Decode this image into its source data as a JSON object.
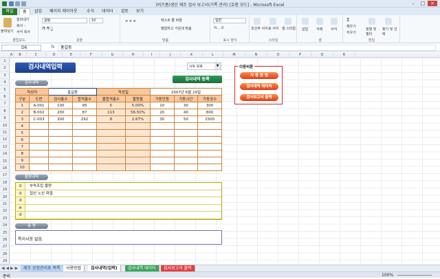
{
  "window": {
    "title": "(비즈폼)생산 제조 검사 보고서(기록 관리) [호환 모드] - Microsoft Excel"
  },
  "ribbon_tabs": [
    "파일",
    "홈",
    "삽입",
    "페이지 레이아웃",
    "수식",
    "데이터",
    "검토",
    "보기"
  ],
  "ribbon": {
    "clipboard": {
      "paste": "붙여넣기",
      "cut": "잘라내기",
      "copy": "복사 -",
      "format": "서식 복사",
      "label": "클립보드"
    },
    "font": {
      "name": "굴림",
      "size": "10",
      "label": "글꼴"
    },
    "align": {
      "wrap": "텍스트 줄 바꿈",
      "merge": "병합하고 가운데 맞춤",
      "label": "맞춤"
    },
    "number": {
      "format": "일반",
      "label": "표시 형식"
    },
    "styles": {
      "cond": "조건부 서식",
      "table": "표 서식",
      "cell": "셀 스타일",
      "label": "스타일"
    },
    "cells": {
      "insert": "삽입",
      "delete": "삭제",
      "format": "서식",
      "label": "셀"
    },
    "edit": {
      "sum": "Σ",
      "fill": "채우기",
      "clear": "지우기",
      "sort": "정렬 및 필터",
      "find": "찾기 및 선택",
      "label": "편집"
    }
  },
  "formula_bar": {
    "cell": "D6",
    "fx": "fx",
    "content": "홍길동"
  },
  "columns": [
    "A",
    "B",
    "C",
    "D",
    "E",
    "F",
    "G",
    "H",
    "I",
    "J",
    "K",
    "L",
    "M",
    "N",
    "O",
    "P",
    "Q",
    "R"
  ],
  "rows": [
    "1",
    "2",
    "3",
    "4",
    "5",
    "6",
    "7",
    "8",
    "9",
    "10",
    "11",
    "12",
    "13",
    "14",
    "15",
    "16",
    "17",
    "18",
    "19",
    "20",
    "21",
    "22",
    "23",
    "24",
    "25",
    "26",
    "27",
    "28",
    "29"
  ],
  "sheet": {
    "title": "검사내역입력",
    "combo_value": "시트 보호",
    "register_button": "검사내역 등록",
    "sec_inspect": "검사내역",
    "author_label": "작성자",
    "author": "홍길동",
    "date_label": "작성일",
    "date": "2007년 6월 29일",
    "headers": [
      "구분",
      "도번",
      "검사총수",
      "합격총수",
      "불합격총수",
      "불량율",
      "가동인원",
      "가동시간",
      "가동공수"
    ],
    "rows": [
      [
        "1",
        "A-001",
        "100",
        "95",
        "5",
        "5.00%",
        "10",
        "30",
        "300"
      ],
      [
        "2",
        "B-002",
        "200",
        "87",
        "113",
        "56.50%",
        "20",
        "40",
        "800"
      ],
      [
        "3",
        "C-003",
        "300",
        "292",
        "8",
        "2.67%",
        "30",
        "50",
        "1500"
      ],
      [
        "4",
        "",
        "",
        "",
        "",
        "",
        "",
        "",
        ""
      ],
      [
        "5",
        "",
        "",
        "",
        "",
        "",
        "",
        "",
        ""
      ],
      [
        "6",
        "",
        "",
        "",
        "",
        "",
        "",
        "",
        ""
      ],
      [
        "7",
        "",
        "",
        "",
        "",
        "",
        "",
        "",
        ""
      ],
      [
        "8",
        "",
        "",
        "",
        "",
        "",
        "",
        "",
        ""
      ],
      [
        "9",
        "",
        "",
        "",
        "",
        "",
        "",
        "",
        ""
      ],
      [
        "10",
        "",
        "",
        "",
        "",
        "",
        "",
        "",
        ""
      ]
    ],
    "sec_defect": "불량내역",
    "defects": [
      [
        "①",
        "부속조립 불량"
      ],
      [
        "②",
        "접선 노선 파열"
      ],
      [
        "③",
        ""
      ],
      [
        "④",
        ""
      ],
      [
        "⑤",
        ""
      ]
    ],
    "sec_summary": "총 평",
    "summary": "특이사항 없음."
  },
  "nav": {
    "title": "이동버튼",
    "buttons": [
      "사 용 방 법",
      "검사내역 데이터",
      "검사보고서 출력"
    ]
  },
  "sheet_tabs": [
    "제조 공정관리표 목록",
    "사용방법",
    "검사내역(입력)",
    "검사내역 데이터",
    "검사보고서 출력"
  ],
  "status": {
    "left": "준비",
    "zoom": "100%"
  },
  "colors": {
    "orange_header": "#f9c79a",
    "orange_light": "#fde6d0",
    "title_blue": "#1c3f8a",
    "nav_red": "#d42a2a",
    "file_green": "#2a7a2a"
  }
}
